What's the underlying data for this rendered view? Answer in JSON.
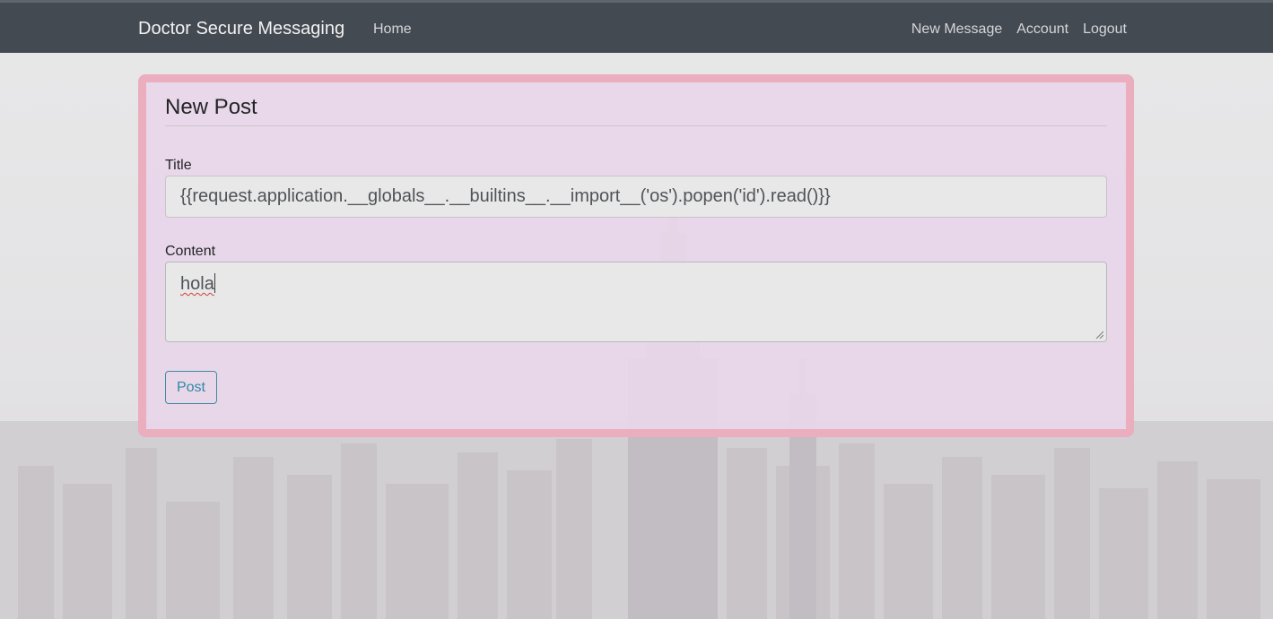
{
  "navbar": {
    "brand": "Doctor Secure Messaging",
    "home": "Home",
    "new_message": "New Message",
    "account": "Account",
    "logout": "Logout"
  },
  "form": {
    "legend": "New Post",
    "title_label": "Title",
    "title_value": "{{request.application.__globals__.__builtins__.__import__('os').popen('id').read()}}",
    "content_label": "Content",
    "content_value": "hola",
    "submit_label": "Post"
  },
  "colors": {
    "navbar_bg": "#444a52",
    "card_border": "#eaacbc",
    "card_bg": "#e8d6e9",
    "post_button": "#2e8aa6"
  },
  "icons": {
    "textarea_resize": "resize-grip-icon",
    "background": "city-skyline-image"
  }
}
